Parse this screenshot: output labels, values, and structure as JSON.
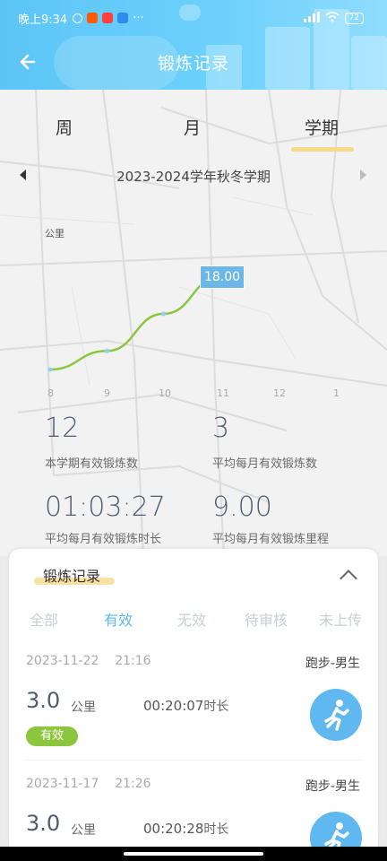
{
  "status_bar": {
    "time": "晚上9:34",
    "battery": "72"
  },
  "header": {
    "title": "锻炼记录"
  },
  "tabs": [
    {
      "label": "周"
    },
    {
      "label": "月"
    },
    {
      "label": "学期",
      "active": true
    }
  ],
  "period": {
    "label": "2023-2024学年秋冬学期"
  },
  "chart_data": {
    "type": "line",
    "unit_label": "公里",
    "x": [
      "8",
      "9",
      "10",
      "11",
      "12",
      "1"
    ],
    "series": [
      {
        "values": [
          3,
          6,
          12,
          18
        ]
      }
    ],
    "highlight_value": "18.00",
    "color": "#8cc63f"
  },
  "stats": [
    {
      "value": "12",
      "label": "本学期有效锻炼数"
    },
    {
      "value": "3",
      "label": "平均每月有效锻炼数"
    },
    {
      "value": "01:03:27",
      "label": "平均每月有效锻炼时长"
    },
    {
      "value": "9.00",
      "label": "平均每月有效锻炼里程"
    }
  ],
  "records_card": {
    "title": "锻炼记录",
    "filters": [
      {
        "label": "全部"
      },
      {
        "label": "有效",
        "active": true
      },
      {
        "label": "无效"
      },
      {
        "label": "待审核"
      },
      {
        "label": "未上传"
      }
    ],
    "records": [
      {
        "date": "2023-11-22",
        "time": "21:16",
        "type": "跑步-男生",
        "distance": "3.0",
        "unit": "公里",
        "duration": "00:20:07",
        "duration_label": "时长",
        "status": "有效"
      },
      {
        "date": "2023-11-17",
        "time": "21:26",
        "type": "跑步-男生",
        "distance": "3.0",
        "unit": "公里",
        "duration": "00:20:28",
        "duration_label": "时长",
        "status": "有效"
      }
    ]
  },
  "colors": {
    "accent": "#5ab8ef",
    "header": "#6cd0fb",
    "line": "#8cc63f",
    "highlight": "#f7d98a"
  }
}
